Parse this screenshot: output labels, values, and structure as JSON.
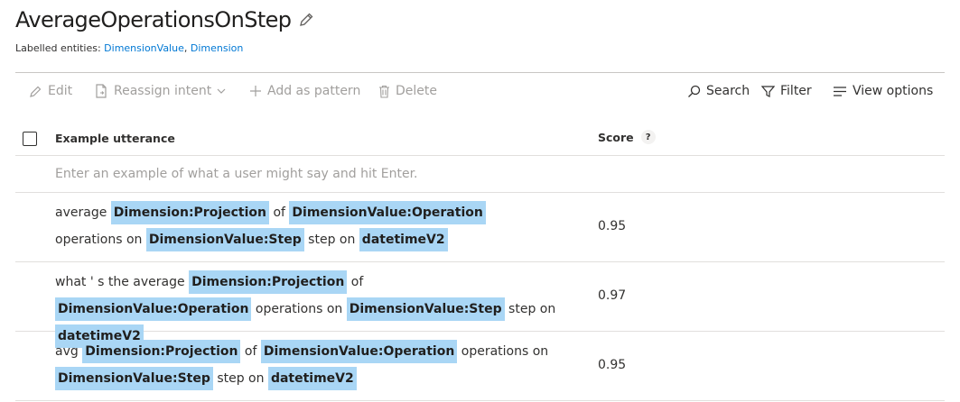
{
  "page": {
    "title": "AverageOperationsOnStep",
    "entities_label": "Labelled entities:",
    "entities": [
      "DimensionValue",
      "Dimension"
    ]
  },
  "toolbar": {
    "edit": "Edit",
    "reassign": "Reassign intent",
    "add_pattern": "Add as pattern",
    "delete": "Delete",
    "search": "Search",
    "filter": "Filter",
    "view_options": "View options"
  },
  "table": {
    "col_utterance": "Example utterance",
    "col_score": "Score",
    "help": "?",
    "placeholder": "Enter an example of what a user might say and hit Enter.",
    "rows": [
      {
        "score": "0.95",
        "tokens": [
          {
            "t": "average",
            "e": false
          },
          {
            "t": "Dimension:Projection",
            "e": true
          },
          {
            "t": "of",
            "e": false
          },
          {
            "t": "DimensionValue:Operation",
            "e": true
          },
          {
            "t": "operations on",
            "e": false
          },
          {
            "t": "DimensionValue:Step",
            "e": true
          },
          {
            "t": "step on",
            "e": false
          },
          {
            "t": "datetimeV2",
            "e": true
          }
        ]
      },
      {
        "score": "0.97",
        "tokens": [
          {
            "t": "what ' s the average",
            "e": false
          },
          {
            "t": "Dimension:Projection",
            "e": true
          },
          {
            "t": "of",
            "e": false
          },
          {
            "t": "DimensionValue:Operation",
            "e": true
          },
          {
            "t": "operations on",
            "e": false
          },
          {
            "t": "DimensionValue:Step",
            "e": true
          },
          {
            "t": "step on",
            "e": false
          },
          {
            "t": "datetimeV2",
            "e": true
          }
        ]
      },
      {
        "score": "0.95",
        "tokens": [
          {
            "t": "avg",
            "e": false
          },
          {
            "t": "Dimension:Projection",
            "e": true
          },
          {
            "t": "of",
            "e": false
          },
          {
            "t": "DimensionValue:Operation",
            "e": true
          },
          {
            "t": "operations on",
            "e": false
          },
          {
            "t": "DimensionValue:Step",
            "e": true
          },
          {
            "t": "step on",
            "e": false
          },
          {
            "t": "datetimeV2",
            "e": true
          }
        ]
      }
    ]
  },
  "colors": {
    "accent": "#0078d4",
    "entity_highlight": "#a9d6f5",
    "disabled_text": "#a19f9d"
  },
  "icons": {
    "edit": "pencil-icon",
    "reassign": "document-icon",
    "add": "plus-icon",
    "delete": "trash-icon",
    "search": "search-icon",
    "filter": "funnel-icon",
    "view": "list-icon"
  }
}
